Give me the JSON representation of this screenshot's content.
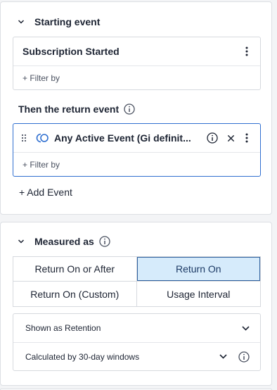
{
  "starting_event": {
    "title": "Starting event",
    "event_name": "Subscription Started",
    "filter_label": "+ Filter by"
  },
  "return_event": {
    "title": "Then the return event",
    "event_name": "Any Active Event (Gi definit...",
    "filter_label": "+ Filter by",
    "logo_color": "#2f6fd0"
  },
  "add_event_label": "+ Add Event",
  "measured_as": {
    "title": "Measured as",
    "options": [
      "Return On or After",
      "Return On",
      "Return On (Custom)",
      "Usage Interval"
    ],
    "selected": "Return On",
    "shown_as": "Shown as Retention",
    "calculated_by": "Calculated by 30-day windows"
  },
  "colors": {
    "accent": "#2f6fd0",
    "selected_bg": "#d6ebfb",
    "selected_border": "#2c5f9e",
    "page_bg": "#f3f4f6",
    "border": "#d6d9de"
  }
}
